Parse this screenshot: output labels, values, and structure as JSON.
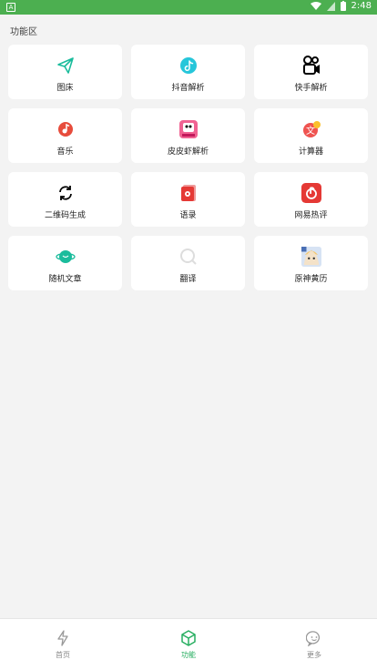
{
  "status_bar": {
    "time": "2:48",
    "left_badge": "A"
  },
  "section": {
    "title": "功能区"
  },
  "features": [
    {
      "label": "图床",
      "icon": "paper-plane-icon"
    },
    {
      "label": "抖音解析",
      "icon": "tiktok-icon"
    },
    {
      "label": "快手解析",
      "icon": "kuaishou-camera-icon"
    },
    {
      "label": "音乐",
      "icon": "music-note-icon"
    },
    {
      "label": "皮皮虾解析",
      "icon": "pipixia-icon"
    },
    {
      "label": "计算器",
      "icon": "translate-icon"
    },
    {
      "label": "二维码生成",
      "icon": "refresh-icon"
    },
    {
      "label": "语录",
      "icon": "flower-card-icon"
    },
    {
      "label": "网易热评",
      "icon": "netease-music-icon"
    },
    {
      "label": "随机文章",
      "icon": "planet-icon"
    },
    {
      "label": "翻译",
      "icon": "search-circle-icon"
    },
    {
      "label": "原神黄历",
      "icon": "anime-avatar-icon"
    }
  ],
  "tabs": [
    {
      "label": "首页",
      "icon": "lightning-icon",
      "active": false
    },
    {
      "label": "功能",
      "icon": "cube-icon",
      "active": true
    },
    {
      "label": "更多",
      "icon": "smiley-bubble-icon",
      "active": false
    }
  ],
  "colors": {
    "status_bar": "#4caf50",
    "accent": "#27ae60",
    "background": "#f3f3f3"
  }
}
